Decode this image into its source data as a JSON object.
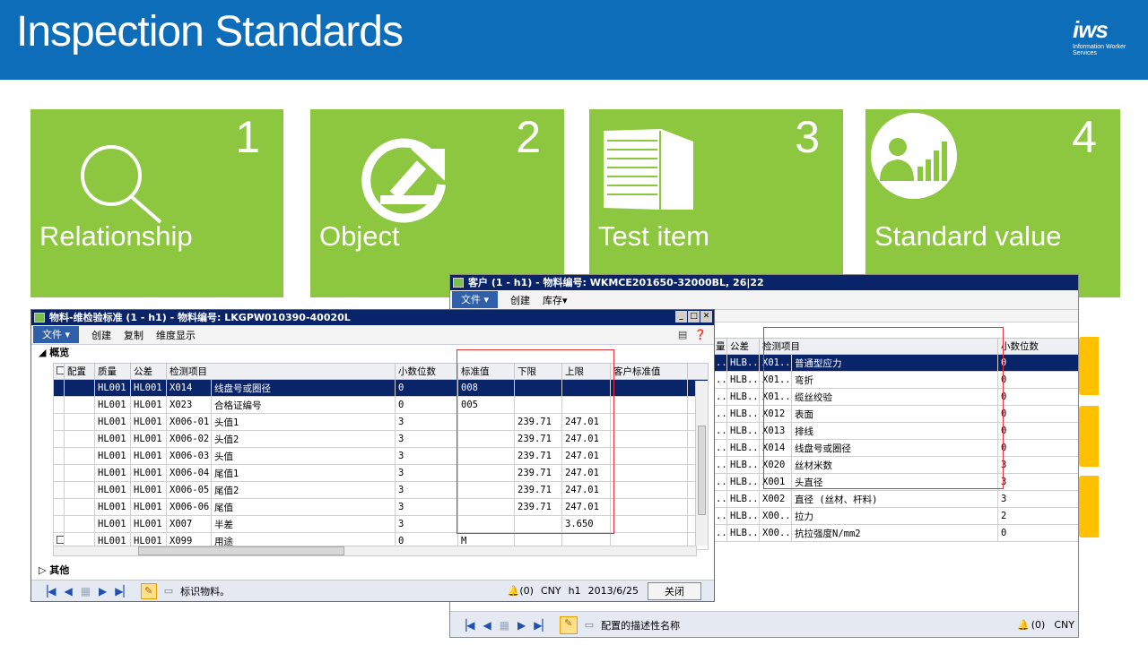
{
  "header": {
    "title": "Inspection Standards",
    "logo_text": "iws",
    "logo_sub": "Information Worker Services"
  },
  "tiles": [
    {
      "num": "1",
      "label": "Relationship",
      "icon": "search-icon"
    },
    {
      "num": "2",
      "label": "Object",
      "icon": "refresh-arrow-icon"
    },
    {
      "num": "3",
      "label": "Test item",
      "icon": "document-stack-icon"
    },
    {
      "num": "4",
      "label": "Standard value",
      "icon": "person-chart-icon"
    }
  ],
  "win_back": {
    "title": "客户 (1 - h1) - 物料编号: WKMCE201650-32000BL, 26|22",
    "menu": {
      "file": "文件 ▾",
      "create": "创建",
      "stock": "库存▾"
    },
    "columns": [
      "量",
      "公差",
      "检测项目",
      "",
      "小数位数"
    ],
    "rows": [
      [
        "...",
        "HLB...",
        "X01...",
        "普通型应力",
        "0"
      ],
      [
        "...",
        "HLB...",
        "X01...",
        "弯折",
        "0"
      ],
      [
        "...",
        "HLB...",
        "X01...",
        "缆丝绞验",
        "0"
      ],
      [
        "...",
        "HLB...",
        "X012",
        "表面",
        "0"
      ],
      [
        "...",
        "HLB...",
        "X013",
        "排线",
        "0"
      ],
      [
        "...",
        "HLB...",
        "X014",
        "线盘号或圈径",
        "0"
      ],
      [
        "...",
        "HLB...",
        "X020",
        "丝材米数",
        "3"
      ],
      [
        "...",
        "HLB...",
        "X001",
        "头直径",
        "3"
      ],
      [
        "...",
        "HLB...",
        "X002",
        "直径 (丝材、杆料)",
        "3"
      ],
      [
        "...",
        "HLB...",
        "X00...",
        "拉力",
        "2"
      ],
      [
        "...",
        "HLB...",
        "X00...",
        "抗拉强度N/mm2",
        "0"
      ]
    ],
    "status": "配置的描述性名称",
    "alerts": "(0)",
    "currency": "CNY"
  },
  "win_front": {
    "title": "物料-维检验标准 (1 - h1) - 物料编号: LKGPW010390-40020L",
    "menu": {
      "file": "文件 ▾",
      "create": "创建",
      "copy": "复制",
      "dims": "维度显示"
    },
    "section_overview": "概览",
    "section_other": "其他",
    "columns": [
      "配置",
      "质量",
      "公差",
      "检测项目",
      "",
      "小数位数",
      "标准值",
      "下限",
      "上限",
      "客户标准值"
    ],
    "rows": [
      [
        "",
        "HL001",
        "HL001",
        "X014",
        "线盘号或圈径",
        "0",
        "008",
        "",
        "",
        ""
      ],
      [
        "",
        "HL001",
        "HL001",
        "X023",
        "合格证编号",
        "0",
        "005",
        "",
        "",
        ""
      ],
      [
        "",
        "HL001",
        "HL001",
        "X006-01",
        "头值1",
        "3",
        "",
        "239.71",
        "247.01",
        ""
      ],
      [
        "",
        "HL001",
        "HL001",
        "X006-02",
        "头值2",
        "3",
        "",
        "239.71",
        "247.01",
        ""
      ],
      [
        "",
        "HL001",
        "HL001",
        "X006-03",
        "头值",
        "3",
        "",
        "239.71",
        "247.01",
        ""
      ],
      [
        "",
        "HL001",
        "HL001",
        "X006-04",
        "尾值1",
        "3",
        "",
        "239.71",
        "247.01",
        ""
      ],
      [
        "",
        "HL001",
        "HL001",
        "X006-05",
        "尾值2",
        "3",
        "",
        "239.71",
        "247.01",
        ""
      ],
      [
        "",
        "HL001",
        "HL001",
        "X006-06",
        "尾值",
        "3",
        "",
        "239.71",
        "247.01",
        ""
      ],
      [
        "",
        "HL001",
        "HL001",
        "X007",
        "半差",
        "3",
        "",
        "",
        "3.650",
        ""
      ],
      [
        "",
        "HL001",
        "HL001",
        "X099",
        "用途",
        "0",
        "M",
        "",
        "",
        ""
      ]
    ],
    "status": "标识物料。",
    "alerts": "(0)",
    "currency": "CNY",
    "company": "h1",
    "date": "2013/6/25",
    "close": "关闭"
  },
  "colors": {
    "header_bg": "#0d6db8",
    "tile_green": "#8dc63f",
    "selection": "#0a246a",
    "red_box": "#e8323c",
    "accent_yellow": "#ffc000"
  }
}
